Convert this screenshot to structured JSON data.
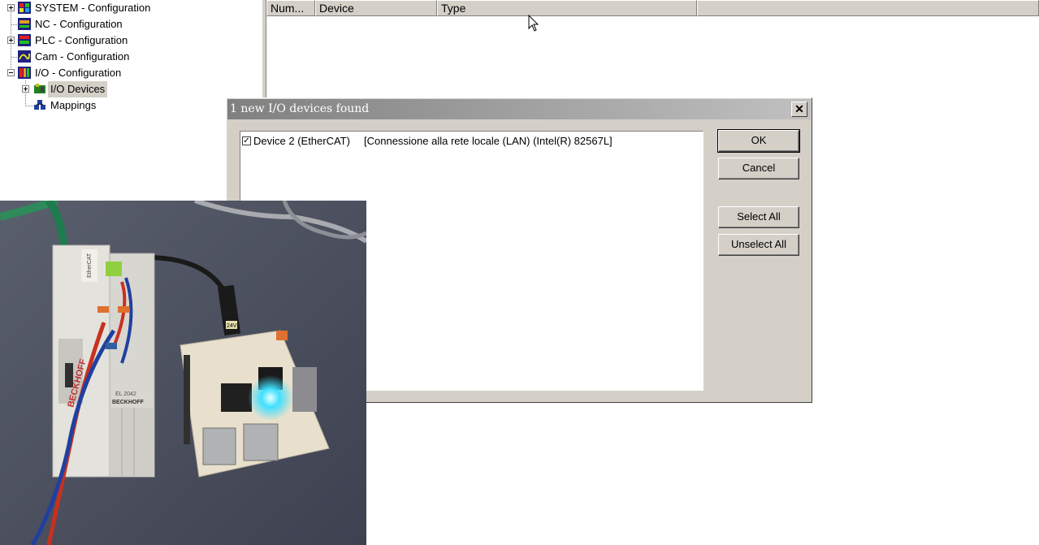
{
  "tree": {
    "items": [
      {
        "label": "SYSTEM - Configuration",
        "icon": "system-config-icon"
      },
      {
        "label": "NC - Configuration",
        "icon": "nc-config-icon"
      },
      {
        "label": "PLC - Configuration",
        "icon": "plc-config-icon"
      },
      {
        "label": "Cam - Configuration",
        "icon": "cam-config-icon"
      },
      {
        "label": "I/O - Configuration",
        "icon": "io-config-icon"
      },
      {
        "label": "I/O Devices",
        "icon": "io-devices-icon"
      },
      {
        "label": "Mappings",
        "icon": "mappings-icon"
      }
    ]
  },
  "list": {
    "columns": [
      "Num...",
      "Device",
      "Type"
    ]
  },
  "dialog": {
    "title": "1 new I/O devices found",
    "close_glyph": "✕",
    "items": [
      {
        "checked": true,
        "check_glyph": "✓",
        "name": "Device 2 (EtherCAT)",
        "adapter": "[Connessione alla rete locale (LAN) (Intel(R) 82567L]"
      }
    ],
    "buttons": {
      "ok": "OK",
      "cancel": "Cancel",
      "select_all": "Select All",
      "unselect_all": "Unselect All"
    }
  },
  "photo": {
    "labels": {
      "brand_left": "BECKHOFF",
      "brand_right": "BECKHOFF",
      "module": "EL 2042",
      "voltage": "24V",
      "ethercat": "EtherCAT"
    }
  }
}
